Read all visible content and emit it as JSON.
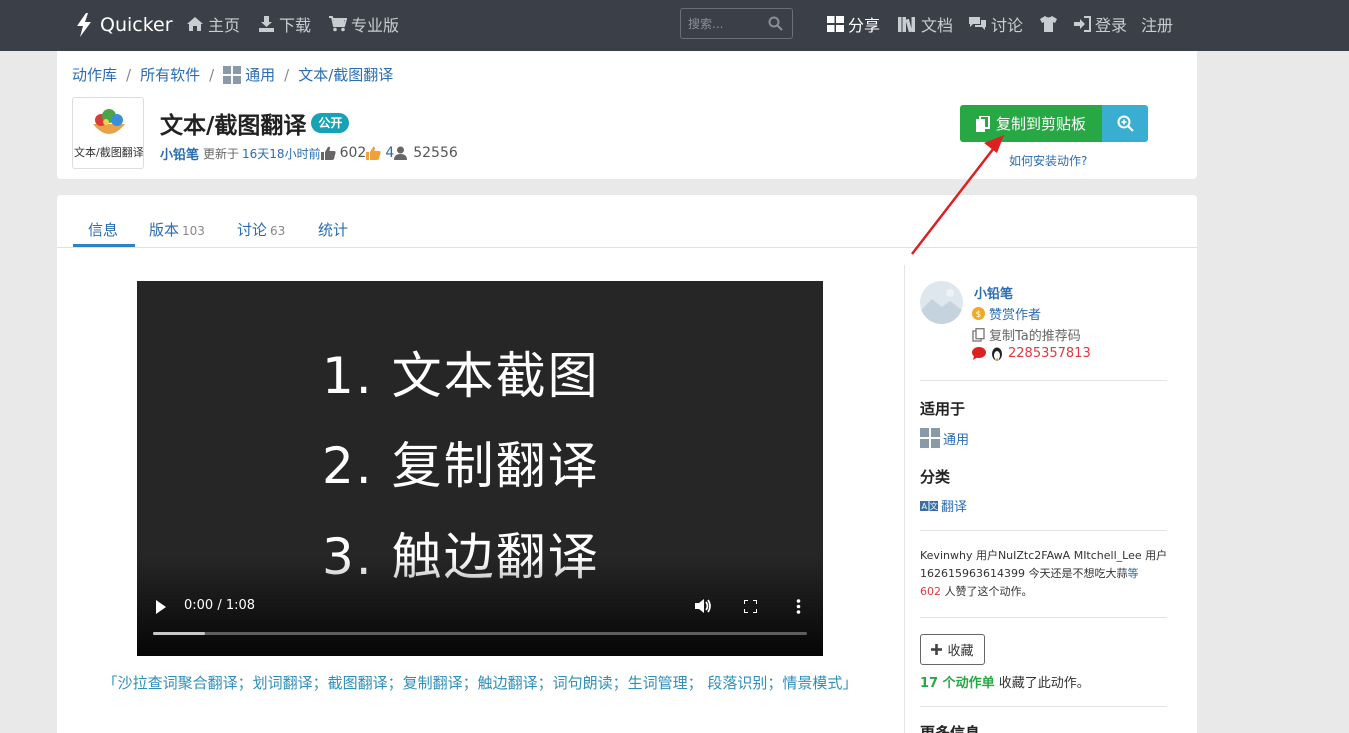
{
  "nav": {
    "brand": "Quicker",
    "home": "主页",
    "download": "下载",
    "pro": "专业版",
    "search_placeholder": "搜索...",
    "share": "分享",
    "docs": "文档",
    "discuss": "讨论",
    "login": "登录",
    "register": "注册"
  },
  "breadcrumb": {
    "library": "动作库",
    "all_software": "所有软件",
    "general": "通用",
    "current": "文本/截图翻译",
    "separator": "/"
  },
  "action": {
    "thumbnail_caption": "文本/截图翻译",
    "title": "文本/截图翻译",
    "visibility_badge": "公开",
    "author": "小铅笔",
    "updated": "更新于",
    "updated_ago": "16天18小时前",
    "likes": "602",
    "thanks": "4",
    "users": "52556"
  },
  "buttons": {
    "copy": "复制到剪贴板",
    "how_to_install": "如何安装动作?"
  },
  "tabs": [
    {
      "label": "信息",
      "count": ""
    },
    {
      "label": "版本",
      "count": "103"
    },
    {
      "label": "讨论",
      "count": "63"
    },
    {
      "label": "统计",
      "count": ""
    }
  ],
  "video": {
    "lines": [
      "1. 文本截图",
      "2. 复制翻译",
      "3. 触边翻译"
    ],
    "time": "0:00 / 1:08",
    "progress": 0.08
  },
  "features_text": "「沙拉查词聚合翻译；划词翻译；截图翻译；复制翻译；触边翻译；词句朗读；生词管理； 段落识别；情景模式」",
  "sidebar": {
    "author_name": "小铅笔",
    "reward": "赞赏作者",
    "copy_referral": "复制Ta的推荐码",
    "qq": "2285357813",
    "applies_to_heading": "适用于",
    "applies_to": "通用",
    "category_heading": "分类",
    "category": "翻译",
    "likes_users": "Kevinwhy 用户NuIZtc2FAwA MItchell_Lee 用户162615963614399 今天还是不想吃大蒜",
    "likes_more": "等",
    "likes_count": "602",
    "likes_suffix": "人赞了这个动作。",
    "favorite_button": "收藏",
    "fav_count": "17 个动作单",
    "fav_suffix": " 收藏了此动作。",
    "more_info": "更多信息"
  },
  "colors": {
    "navbar": "#3b3f47",
    "copy_button": "#28a745",
    "zoom_button": "#3aaed0",
    "link": "#2a6db0",
    "annotation_arrow": "#e02020"
  }
}
